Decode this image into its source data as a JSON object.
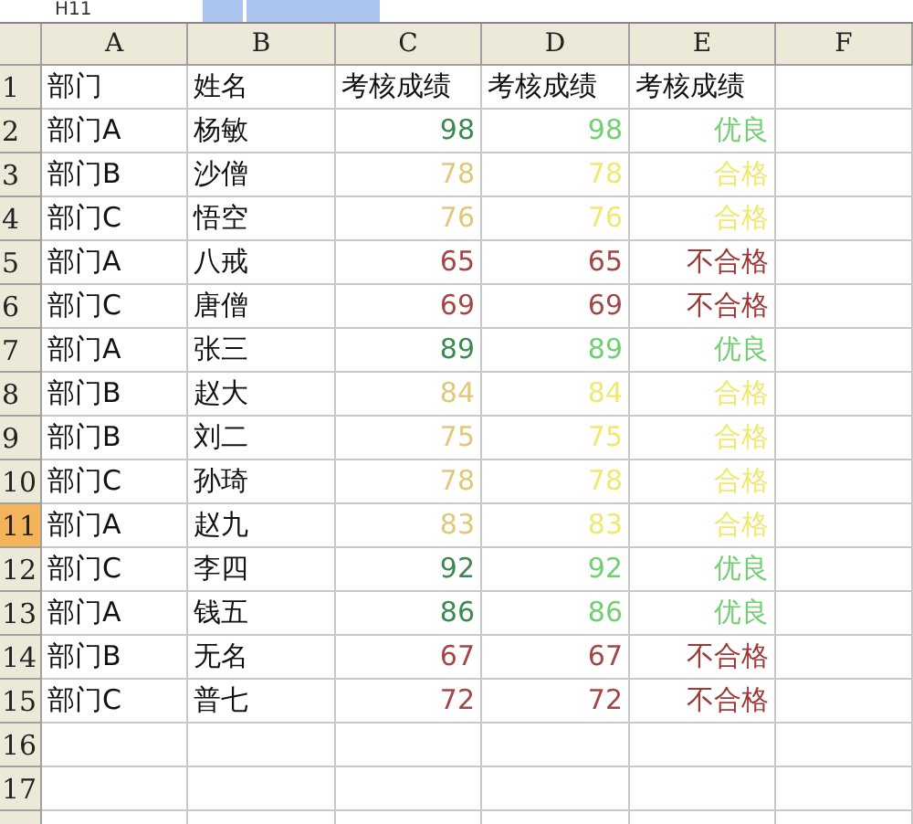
{
  "name_box": "H11",
  "columns": [
    {
      "label": "A",
      "selected": false
    },
    {
      "label": "B",
      "selected": false
    },
    {
      "label": "C",
      "selected": false
    },
    {
      "label": "D",
      "selected": false
    },
    {
      "label": "E",
      "selected": false
    },
    {
      "label": "F",
      "selected": false
    }
  ],
  "rows": [
    {
      "number": "1",
      "selected": false,
      "cells": [
        {
          "text": "部门"
        },
        {
          "text": "姓名"
        },
        {
          "text": "考核成绩"
        },
        {
          "text": "考核成绩"
        },
        {
          "text": "考核成绩"
        }
      ]
    },
    {
      "number": "2",
      "selected": false,
      "cells": [
        {
          "text": "部门A"
        },
        {
          "text": "杨敏"
        },
        {
          "text": "98",
          "color": "#3a8a50"
        },
        {
          "text": "98",
          "color": "#70d070"
        },
        {
          "text": "优良",
          "color": "#70d070"
        }
      ]
    },
    {
      "number": "3",
      "selected": false,
      "cells": [
        {
          "text": "部门B"
        },
        {
          "text": "沙僧"
        },
        {
          "text": "78",
          "color": "#e0c878"
        },
        {
          "text": "78",
          "color": "#f0e870"
        },
        {
          "text": "合格",
          "color": "#f0e870"
        }
      ]
    },
    {
      "number": "4",
      "selected": false,
      "cells": [
        {
          "text": "部门C"
        },
        {
          "text": "悟空"
        },
        {
          "text": "76",
          "color": "#e0c878"
        },
        {
          "text": "76",
          "color": "#f0e870"
        },
        {
          "text": "合格",
          "color": "#f0e870"
        }
      ]
    },
    {
      "number": "5",
      "selected": false,
      "cells": [
        {
          "text": "部门A"
        },
        {
          "text": "八戒"
        },
        {
          "text": "65",
          "color": "#a04848"
        },
        {
          "text": "65",
          "color": "#a04848"
        },
        {
          "text": "不合格",
          "color": "#a03838"
        }
      ]
    },
    {
      "number": "6",
      "selected": false,
      "cells": [
        {
          "text": "部门C"
        },
        {
          "text": "唐僧"
        },
        {
          "text": "69",
          "color": "#a04848"
        },
        {
          "text": "69",
          "color": "#a04848"
        },
        {
          "text": "不合格",
          "color": "#a03838"
        }
      ]
    },
    {
      "number": "7",
      "selected": false,
      "cells": [
        {
          "text": "部门A"
        },
        {
          "text": "张三"
        },
        {
          "text": "89",
          "color": "#3a8a50"
        },
        {
          "text": "89",
          "color": "#70d070"
        },
        {
          "text": "优良",
          "color": "#70d070"
        }
      ]
    },
    {
      "number": "8",
      "selected": false,
      "cells": [
        {
          "text": "部门B"
        },
        {
          "text": "赵大"
        },
        {
          "text": "84",
          "color": "#e0c878"
        },
        {
          "text": "84",
          "color": "#f0e870"
        },
        {
          "text": "合格",
          "color": "#f0e870"
        }
      ]
    },
    {
      "number": "9",
      "selected": false,
      "cells": [
        {
          "text": "部门B"
        },
        {
          "text": "刘二"
        },
        {
          "text": "75",
          "color": "#e0c878"
        },
        {
          "text": "75",
          "color": "#f0e870"
        },
        {
          "text": "合格",
          "color": "#f0e870"
        }
      ]
    },
    {
      "number": "10",
      "selected": false,
      "cells": [
        {
          "text": "部门C"
        },
        {
          "text": "孙琦"
        },
        {
          "text": "78",
          "color": "#e0c878"
        },
        {
          "text": "78",
          "color": "#f0e870"
        },
        {
          "text": "合格",
          "color": "#f0e870"
        }
      ]
    },
    {
      "number": "11",
      "selected": true,
      "cells": [
        {
          "text": "部门A"
        },
        {
          "text": "赵九"
        },
        {
          "text": "83",
          "color": "#e0c878"
        },
        {
          "text": "83",
          "color": "#f0e870"
        },
        {
          "text": "合格",
          "color": "#f0e870"
        }
      ]
    },
    {
      "number": "12",
      "selected": false,
      "cells": [
        {
          "text": "部门C"
        },
        {
          "text": "李四"
        },
        {
          "text": "92",
          "color": "#3a8a50"
        },
        {
          "text": "92",
          "color": "#70d070"
        },
        {
          "text": "优良",
          "color": "#70d070"
        }
      ]
    },
    {
      "number": "13",
      "selected": false,
      "cells": [
        {
          "text": "部门A"
        },
        {
          "text": "钱五"
        },
        {
          "text": "86",
          "color": "#3a8a50"
        },
        {
          "text": "86",
          "color": "#70d070"
        },
        {
          "text": "优良",
          "color": "#70d070"
        }
      ]
    },
    {
      "number": "14",
      "selected": false,
      "cells": [
        {
          "text": "部门B"
        },
        {
          "text": "无名"
        },
        {
          "text": "67",
          "color": "#a04848"
        },
        {
          "text": "67",
          "color": "#a04848"
        },
        {
          "text": "不合格",
          "color": "#a03838"
        }
      ]
    },
    {
      "number": "15",
      "selected": false,
      "cells": [
        {
          "text": "部门C"
        },
        {
          "text": "普七"
        },
        {
          "text": "72",
          "color": "#a04848"
        },
        {
          "text": "72",
          "color": "#a04848"
        },
        {
          "text": "不合格",
          "color": "#a03838"
        }
      ]
    },
    {
      "number": "16",
      "selected": false
    },
    {
      "number": "17",
      "selected": false
    }
  ]
}
